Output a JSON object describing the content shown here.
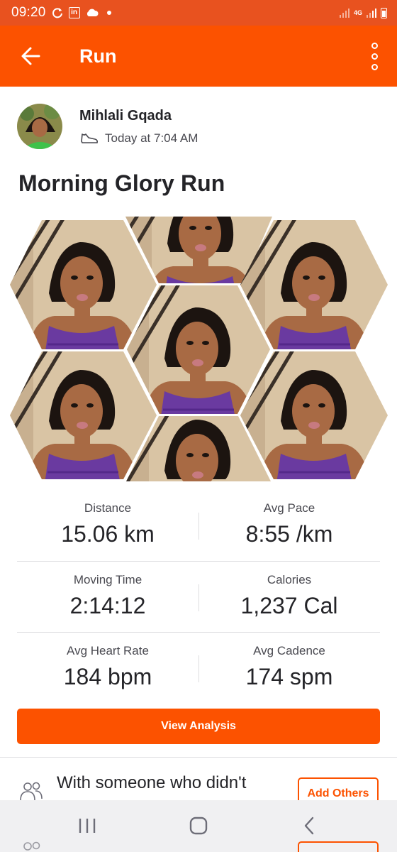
{
  "status_bar": {
    "time": "09:20",
    "network": "4G",
    "linkedin_badge": "in"
  },
  "app_bar": {
    "title": "Run"
  },
  "athlete": {
    "name": "Mihlali Gqada",
    "date": "Today at 7:04 AM"
  },
  "activity": {
    "title": "Morning Glory Run"
  },
  "stats": [
    {
      "label": "Distance",
      "value": "15.06 km"
    },
    {
      "label": "Avg Pace",
      "value": "8:55 /km"
    },
    {
      "label": "Moving Time",
      "value": "2:14:12"
    },
    {
      "label": "Calories",
      "value": "1,237 Cal"
    },
    {
      "label": "Avg Heart Rate",
      "value": "184 bpm"
    },
    {
      "label": "Avg Cadence",
      "value": "174 spm"
    }
  ],
  "buttons": {
    "view_analysis": "View Analysis",
    "add_others": "Add Others"
  },
  "with_others": {
    "text": "With someone who didn't"
  },
  "colors": {
    "status_bar": "#e8521f",
    "accent": "#fc5200",
    "outfit": "#6a3aa0",
    "skin": "#a86a44",
    "hair": "#1c1410"
  }
}
